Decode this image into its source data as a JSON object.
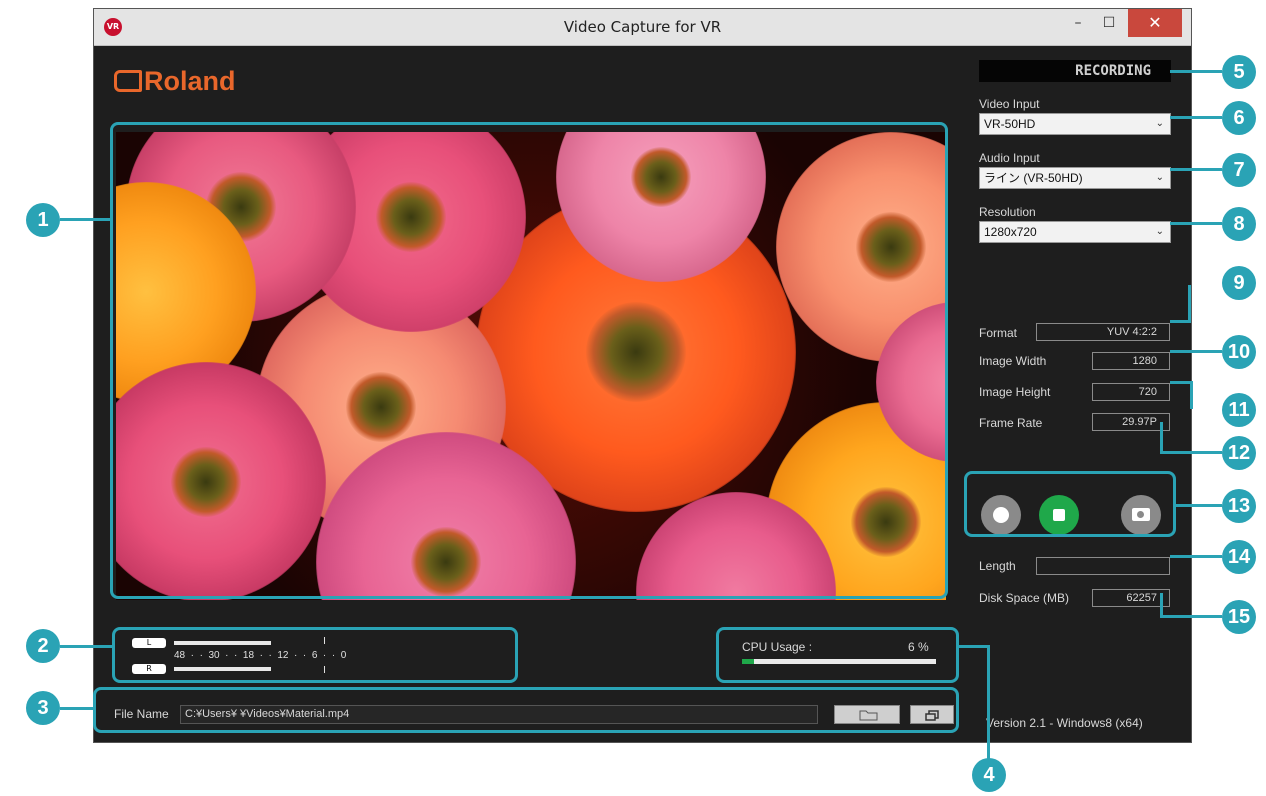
{
  "window": {
    "title": "Video Capture for VR",
    "app_icon_text": "VR",
    "minimize_glyph": "–",
    "maximize_glyph": "☐",
    "close_glyph": "✕"
  },
  "logo": {
    "text": "Roland"
  },
  "status": {
    "recording": "RECORDING"
  },
  "video_input": {
    "label": "Video Input",
    "value": "VR-50HD"
  },
  "audio_input": {
    "label": "Audio Input",
    "value": "ライン (VR-50HD)"
  },
  "resolution": {
    "label": "Resolution",
    "value": "1280x720"
  },
  "info": {
    "format_label": "Format",
    "format_value": "YUV 4:2:2",
    "width_label": "Image Width",
    "width_value": "1280",
    "height_label": "Image Height",
    "height_value": "720",
    "framerate_label": "Frame Rate",
    "framerate_value": "29.97P"
  },
  "length": {
    "label": "Length",
    "value": ""
  },
  "disk": {
    "label": "Disk Space (MB)",
    "value": "62257"
  },
  "meter": {
    "left_tag": "L",
    "right_tag": "R",
    "scale": [
      "48",
      "30",
      "18",
      "12",
      "6",
      "0"
    ],
    "left_level": 0.42,
    "right_level": 0.42
  },
  "cpu": {
    "label": "CPU Usage :",
    "value": "6 %",
    "level": 0.06
  },
  "file": {
    "label": "File Name",
    "path": "C:¥Users¥                    ¥Videos¥Material.mp4"
  },
  "version": "Version 2.1 - Windows8 (x64)",
  "callouts": [
    "1",
    "2",
    "3",
    "4",
    "5",
    "6",
    "7",
    "8",
    "9",
    "10",
    "11",
    "12",
    "13",
    "14",
    "15"
  ],
  "colors": {
    "accent": "#2aa3b5",
    "brand": "#e9672b",
    "stop_button": "#1fa84a"
  }
}
